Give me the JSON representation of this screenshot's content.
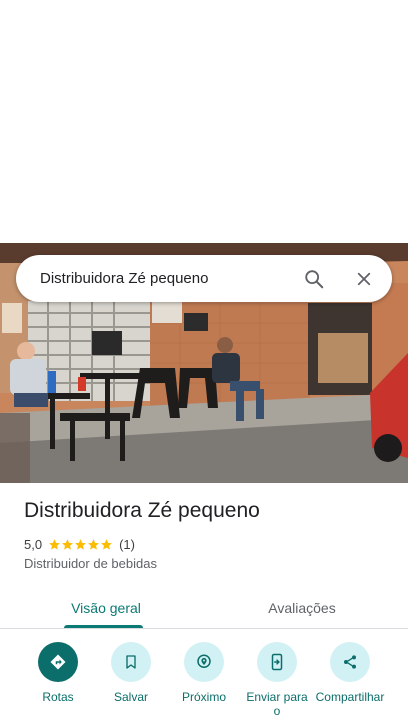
{
  "search": {
    "query": "Distribuidora Zé pequeno"
  },
  "place": {
    "name": "Distribuidora Zé pequeno",
    "rating": "5,0",
    "rating_value": 5,
    "review_count": "(1)",
    "category": "Distribuidor de bebidas"
  },
  "tabs": [
    {
      "label": "Visão geral",
      "active": true
    },
    {
      "label": "Avaliações",
      "active": false
    }
  ],
  "actions": [
    {
      "label": "Rotas",
      "icon": "directions-icon"
    },
    {
      "label": "Salvar",
      "icon": "bookmark-icon"
    },
    {
      "label": "Próximo",
      "icon": "nearby-icon"
    },
    {
      "label": "Enviar para o",
      "icon": "send-to-phone-icon"
    },
    {
      "label": "Compartilhar",
      "icon": "share-icon"
    }
  ],
  "colors": {
    "accent": "#0b7a74",
    "action_bg": "#d2f1f4",
    "star": "#fbbc04"
  }
}
